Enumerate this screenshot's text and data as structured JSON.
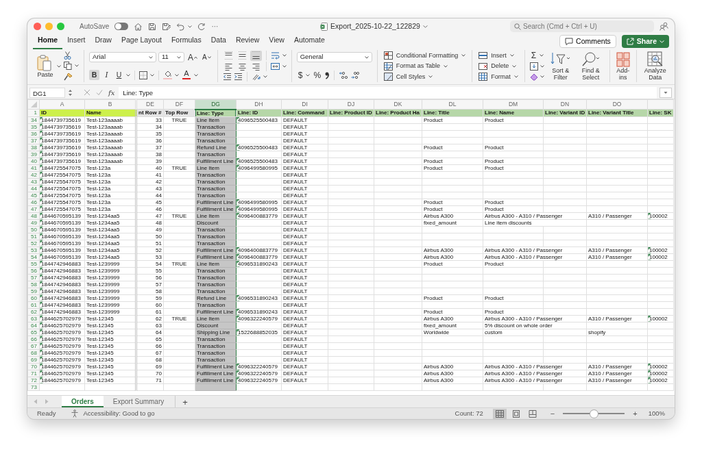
{
  "window": {
    "title": "Export_2025-10-22_122829"
  },
  "title_bar": {
    "autosave_label": "AutoSave",
    "autosave_on": false,
    "more": "···",
    "search": {
      "placeholder": "Search (Cmd + Ctrl + U)"
    }
  },
  "ribbon_tabs": [
    {
      "label": "Home",
      "selected": true
    },
    {
      "label": "Insert",
      "selected": false
    },
    {
      "label": "Draw",
      "selected": false
    },
    {
      "label": "Page Layout",
      "selected": false
    },
    {
      "label": "Formulas",
      "selected": false
    },
    {
      "label": "Data",
      "selected": false
    },
    {
      "label": "Review",
      "selected": false
    },
    {
      "label": "View",
      "selected": false
    },
    {
      "label": "Automate",
      "selected": false
    }
  ],
  "comments_button": "Comments",
  "share_button": "Share",
  "ribbon": {
    "paste": "Paste",
    "font": {
      "name": "Arial",
      "size": "11",
      "grow": "A",
      "shrink": "A",
      "color_letter": "A",
      "styles": [
        {
          "label": "B",
          "kind": "bold",
          "on": true
        },
        {
          "label": "I",
          "kind": "italic",
          "on": false
        },
        {
          "label": "U",
          "kind": "underline",
          "on": false
        }
      ]
    },
    "vertical_align": [
      {
        "kind": "top",
        "selected": false
      },
      {
        "kind": "middle",
        "selected": false
      },
      {
        "kind": "bottom",
        "selected": true
      }
    ],
    "horizontal_align": [
      {
        "kind": "left",
        "selected": false
      },
      {
        "kind": "center",
        "selected": false
      },
      {
        "kind": "right",
        "selected": false
      }
    ],
    "number_format": "General",
    "currency": "$",
    "percent": "%",
    "styles": [
      "Conditional Formatting",
      "Format as Table",
      "Cell Styles"
    ],
    "cells": [
      "Insert",
      "Delete",
      "Format"
    ],
    "autosum": "Σ",
    "sort_filter": "Sort & Filter",
    "find_select": "Find & Select",
    "add_ins": "Add-ins",
    "analyze_data": "Analyze Data"
  },
  "formula_bar": {
    "name_box": "DG1",
    "fx": "fx",
    "formula": "Line: Type"
  },
  "sheet": {
    "header_row_number": "1",
    "columns": [
      {
        "letter": "A",
        "header": "ID",
        "color": "#cdf04b",
        "selected": false
      },
      {
        "letter": "B",
        "header": "Name",
        "color": "#cdf04b",
        "selected": false
      },
      {
        "letter": "DE",
        "header": "nt Row #",
        "color": "#e4e4e4",
        "selected": false
      },
      {
        "letter": "DF",
        "header": "Top Row",
        "color": "#e4e4e4",
        "selected": false
      },
      {
        "letter": "DG",
        "header": "Line: Type",
        "color": "#b6d7a8",
        "selected": true
      },
      {
        "letter": "DH",
        "header": "Line: ID",
        "color": "#b6d7a8",
        "selected": false
      },
      {
        "letter": "DI",
        "header": "Line: Command",
        "color": "#b6d7a8",
        "selected": false
      },
      {
        "letter": "DJ",
        "header": "Line: Product ID",
        "color": "#b6d7a8",
        "selected": false
      },
      {
        "letter": "DK",
        "header": "Line: Product Ha",
        "color": "#b6d7a8",
        "selected": false
      },
      {
        "letter": "DL",
        "header": "Line: Title",
        "color": "#b6d7a8",
        "selected": false
      },
      {
        "letter": "DM",
        "header": "Line: Name",
        "color": "#b6d7a8",
        "selected": false
      },
      {
        "letter": "DN",
        "header": "Line: Variant ID",
        "color": "#b6d7a8",
        "selected": false
      },
      {
        "letter": "DO",
        "header": "Line: Variant Title",
        "color": "#b6d7a8",
        "selected": false
      },
      {
        "header": "Line: SK",
        "color": "#b6d7a8",
        "selected": false
      }
    ],
    "rows": [
      {
        "row": "34",
        "A": "1844739735619",
        "B": "Test-123aaaab",
        "DE": "33",
        "DF": "TRUE",
        "DG": "Line Item",
        "DH": "4096525500483",
        "DI": "DEFAULT",
        "DL": "Product",
        "DM": "Product"
      },
      {
        "row": "35",
        "A": "1844739735619",
        "B": "Test-123aaaab",
        "DE": "34",
        "DG": "Transaction",
        "DI": "DEFAULT"
      },
      {
        "row": "36",
        "A": "1844739735619",
        "B": "Test-123aaaab",
        "DE": "35",
        "DG": "Transaction",
        "DI": "DEFAULT"
      },
      {
        "row": "37",
        "A": "1844739735619",
        "B": "Test-123aaaab",
        "DE": "36",
        "DG": "Transaction",
        "DI": "DEFAULT"
      },
      {
        "row": "38",
        "A": "1844739735619",
        "B": "Test-123aaaab",
        "DE": "37",
        "DG": "Refund Line",
        "DH": "4096525500483",
        "DI": "DEFAULT",
        "DL": "Product",
        "DM": "Product"
      },
      {
        "row": "39",
        "A": "1844739735619",
        "B": "Test-123aaaab",
        "DE": "38",
        "DG": "Transaction",
        "DI": "DEFAULT"
      },
      {
        "row": "40",
        "A": "1844739735619",
        "B": "Test-123aaaab",
        "DE": "39",
        "DG": "Fulfillment Line",
        "DH": "4096525500483",
        "DI": "DEFAULT",
        "DL": "Product",
        "DM": "Product"
      },
      {
        "row": "41",
        "A": "1844725547075",
        "B": "Test-123a",
        "DE": "40",
        "DF": "TRUE",
        "DG": "Line Item",
        "DH": "4096499580995",
        "DI": "DEFAULT",
        "DL": "Product",
        "DM": "Product"
      },
      {
        "row": "42",
        "A": "1844725547075",
        "B": "Test-123a",
        "DE": "41",
        "DG": "Transaction",
        "DI": "DEFAULT"
      },
      {
        "row": "43",
        "A": "1844725547075",
        "B": "Test-123a",
        "DE": "42",
        "DG": "Transaction",
        "DI": "DEFAULT"
      },
      {
        "row": "44",
        "A": "1844725547075",
        "B": "Test-123a",
        "DE": "43",
        "DG": "Transaction",
        "DI": "DEFAULT"
      },
      {
        "row": "45",
        "A": "1844725547075",
        "B": "Test-123a",
        "DE": "44",
        "DG": "Transaction",
        "DI": "DEFAULT"
      },
      {
        "row": "46",
        "A": "1844725547075",
        "B": "Test-123a",
        "DE": "45",
        "DG": "Fulfillment Line",
        "DH": "4096499580995",
        "DI": "DEFAULT",
        "DL": "Product",
        "DM": "Product"
      },
      {
        "row": "47",
        "A": "1844725547075",
        "B": "Test-123a",
        "DE": "46",
        "DG": "Fulfillment Line",
        "DH": "4096499580995",
        "DI": "DEFAULT",
        "DL": "Product",
        "DM": "Product"
      },
      {
        "row": "48",
        "A": "1844670595139",
        "B": "Test-1234aa5",
        "DE": "47",
        "DF": "TRUE",
        "DG": "Line Item",
        "DH": "4096400883779",
        "DI": "DEFAULT",
        "DL": "Airbus A300",
        "DM": "Airbus A300 - A310 / Passenger",
        "DO": "A310 / Passenger",
        "column_14": "100002"
      },
      {
        "row": "49",
        "A": "1844670595139",
        "B": "Test-1234aa5",
        "DE": "48",
        "DG": "Discount",
        "DI": "DEFAULT",
        "DL": "fixed_amount",
        "DM": "Line item discounts"
      },
      {
        "row": "50",
        "A": "1844670595139",
        "B": "Test-1234aa5",
        "DE": "49",
        "DG": "Transaction",
        "DI": "DEFAULT"
      },
      {
        "row": "51",
        "A": "1844670595139",
        "B": "Test-1234aa5",
        "DE": "50",
        "DG": "Transaction",
        "DI": "DEFAULT"
      },
      {
        "row": "52",
        "A": "1844670595139",
        "B": "Test-1234aa5",
        "DE": "51",
        "DG": "Transaction",
        "DI": "DEFAULT"
      },
      {
        "row": "53",
        "A": "1844670595139",
        "B": "Test-1234aa5",
        "DE": "52",
        "DG": "Fulfillment Line",
        "DH": "4096400883779",
        "DI": "DEFAULT",
        "DL": "Airbus A300",
        "DM": "Airbus A300 - A310 / Passenger",
        "DO": "A310 / Passenger",
        "column_14": "100002"
      },
      {
        "row": "54",
        "A": "1844670595139",
        "B": "Test-1234aa5",
        "DE": "53",
        "DG": "Fulfillment Line",
        "DH": "4096400883779",
        "DI": "DEFAULT",
        "DL": "Airbus A300",
        "DM": "Airbus A300 - A310 / Passenger",
        "DO": "A310 / Passenger",
        "column_14": "100002"
      },
      {
        "row": "55",
        "A": "1844742946883",
        "B": "Test-1239999",
        "DE": "54",
        "DF": "TRUE",
        "DG": "Line Item",
        "DH": "4096531890243",
        "DI": "DEFAULT",
        "DL": "Product",
        "DM": "Product"
      },
      {
        "row": "56",
        "A": "1844742946883",
        "B": "Test-1239999",
        "DE": "55",
        "DG": "Transaction",
        "DI": "DEFAULT"
      },
      {
        "row": "57",
        "A": "1844742946883",
        "B": "Test-1239999",
        "DE": "56",
        "DG": "Transaction",
        "DI": "DEFAULT"
      },
      {
        "row": "58",
        "A": "1844742946883",
        "B": "Test-1239999",
        "DE": "57",
        "DG": "Transaction",
        "DI": "DEFAULT"
      },
      {
        "row": "59",
        "A": "1844742946883",
        "B": "Test-1239999",
        "DE": "58",
        "DG": "Transaction",
        "DI": "DEFAULT"
      },
      {
        "row": "60",
        "A": "1844742946883",
        "B": "Test-1239999",
        "DE": "59",
        "DG": "Refund Line",
        "DH": "4096531890243",
        "DI": "DEFAULT",
        "DL": "Product",
        "DM": "Product"
      },
      {
        "row": "61",
        "A": "1844742946883",
        "B": "Test-1239999",
        "DE": "60",
        "DG": "Transaction",
        "DI": "DEFAULT"
      },
      {
        "row": "62",
        "A": "1844742946883",
        "B": "Test-1239999",
        "DE": "61",
        "DG": "Fulfillment Line",
        "DH": "4096531890243",
        "DI": "DEFAULT",
        "DL": "Product",
        "DM": "Product"
      },
      {
        "row": "63",
        "A": "1844625702979",
        "B": "Test-12345",
        "DE": "62",
        "DF": "TRUE",
        "DG": "Line Item",
        "DH": "4096322240579",
        "DI": "DEFAULT",
        "DL": "Airbus A300",
        "DM": "Airbus A300 - A310 / Passenger",
        "DO": "A310 / Passenger",
        "column_14": "100002"
      },
      {
        "row": "64",
        "A": "1844625702979",
        "B": "Test-12345",
        "DE": "63",
        "DG": "Discount",
        "DI": "DEFAULT",
        "DL": "fixed_amount",
        "DM": "5% discount on whole order"
      },
      {
        "row": "65",
        "A": "1844625702979",
        "B": "Test-12345",
        "DE": "64",
        "DG": "Shipping Line",
        "DH": "1522688852035",
        "DI": "DEFAULT",
        "DL": "Worldwide",
        "DM": "custom",
        "DO": "shopify"
      },
      {
        "row": "66",
        "A": "1844625702979",
        "B": "Test-12345",
        "DE": "65",
        "DG": "Transaction",
        "DI": "DEFAULT"
      },
      {
        "row": "67",
        "A": "1844625702979",
        "B": "Test-12345",
        "DE": "66",
        "DG": "Transaction",
        "DI": "DEFAULT"
      },
      {
        "row": "68",
        "A": "1844625702979",
        "B": "Test-12345",
        "DE": "67",
        "DG": "Transaction",
        "DI": "DEFAULT"
      },
      {
        "row": "69",
        "A": "1844625702979",
        "B": "Test-12345",
        "DE": "68",
        "DG": "Transaction",
        "DI": "DEFAULT"
      },
      {
        "row": "70",
        "A": "1844625702979",
        "B": "Test-12345",
        "DE": "69",
        "DG": "Fulfillment Line",
        "DH": "4096322240579",
        "DI": "DEFAULT",
        "DL": "Airbus A300",
        "DM": "Airbus A300 - A310 / Passenger",
        "DO": "A310 / Passenger",
        "column_14": "100002"
      },
      {
        "row": "71",
        "A": "1844625702979",
        "B": "Test-12345",
        "DE": "70",
        "DG": "Fulfillment Line",
        "DH": "4096322240579",
        "DI": "DEFAULT",
        "DL": "Airbus A300",
        "DM": "Airbus A300 - A310 / Passenger",
        "DO": "A310 / Passenger",
        "column_14": "100002"
      },
      {
        "row": "72",
        "A": "1844625702979",
        "B": "Test-12345",
        "DE": "71",
        "DG": "Fulfillment Line",
        "DH": "4096322240579",
        "DI": "DEFAULT",
        "DL": "Airbus A300",
        "DM": "Airbus A300 - A310 / Passenger",
        "DO": "A310 / Passenger",
        "column_14": "100002"
      },
      {
        "row": "73"
      }
    ]
  },
  "sheet_tabs": [
    {
      "label": "Orders",
      "selected": true
    },
    {
      "label": "Export Summary",
      "selected": false
    }
  ],
  "add_sheet": "+",
  "status_bar": {
    "mode": "Ready",
    "accessibility": "Accessibility: Good to go",
    "count": "Count: 72",
    "views": [
      {
        "kind": "normal",
        "selected": true
      },
      {
        "kind": "page_layout",
        "selected": false
      },
      {
        "kind": "page_break",
        "selected": false
      }
    ],
    "zoom": {
      "minus": "−",
      "plus": "+",
      "level": 0.5,
      "reading": "100%"
    }
  }
}
